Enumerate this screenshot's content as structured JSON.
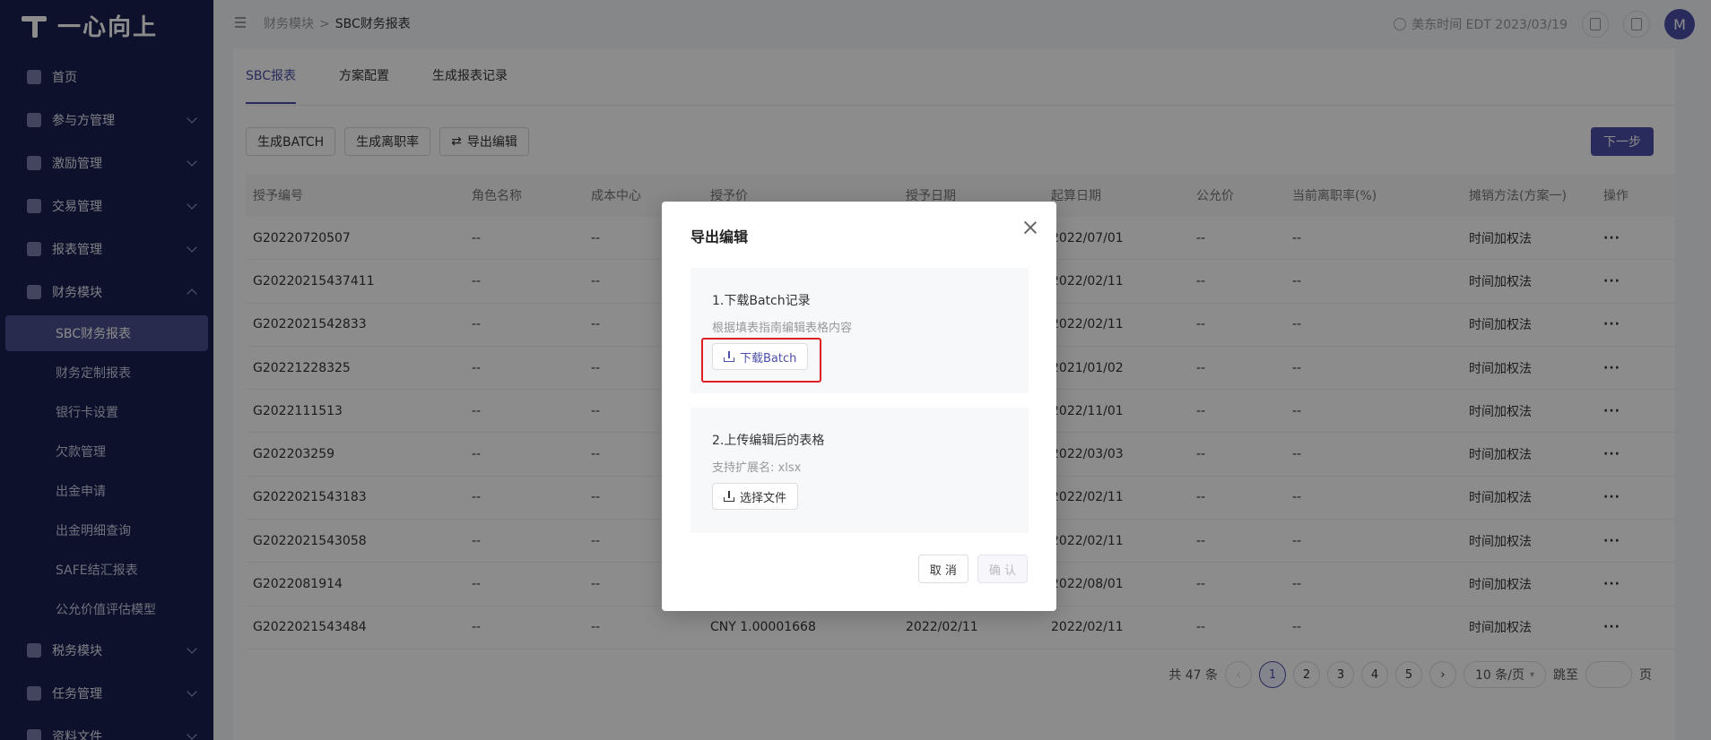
{
  "app": {
    "logo_text": "一心向上"
  },
  "sidebar": {
    "items": [
      {
        "label": "首页",
        "expandable": false
      },
      {
        "label": "参与方管理",
        "expandable": true
      },
      {
        "label": "激励管理",
        "expandable": true
      },
      {
        "label": "交易管理",
        "expandable": true
      },
      {
        "label": "报表管理",
        "expandable": true
      },
      {
        "label": "财务模块",
        "expandable": true,
        "expanded": true
      }
    ],
    "sub_items": [
      "SBC财务报表",
      "财务定制报表",
      "银行卡设置",
      "欠款管理",
      "出金申请",
      "出金明细查询",
      "SAFE结汇报表",
      "公允价值评估模型"
    ],
    "bottom_items": [
      {
        "label": "税务模块"
      },
      {
        "label": "任务管理"
      },
      {
        "label": "资料文件"
      }
    ]
  },
  "header": {
    "breadcrumb": [
      "财务模块",
      "SBC财务报表"
    ],
    "breadcrumb_sep": ">",
    "time_label": "美东时间 EDT 2023/03/19",
    "avatar_letter": "M"
  },
  "tabs": [
    "SBC报表",
    "方案配置",
    "生成报表记录"
  ],
  "toolbar": {
    "gen_batch": "生成BATCH",
    "gen_leave": "生成离职率",
    "export_edit": "导出编辑",
    "next": "下一步"
  },
  "table": {
    "columns": [
      "授予编号",
      "角色名称",
      "成本中心",
      "授予价",
      "授予日期",
      "起算日期",
      "公允价",
      "当前离职率(%)",
      "摊销方法(方案一)",
      "操作"
    ],
    "rows": [
      [
        "G20220720507",
        "--",
        "--",
        "",
        "",
        "2022/07/01",
        "--",
        "--",
        "时间加权法"
      ],
      [
        "G20220215437411",
        "--",
        "--",
        "",
        "",
        "2022/02/11",
        "--",
        "--",
        "时间加权法"
      ],
      [
        "G2022021542833",
        "--",
        "--",
        "",
        "",
        "2022/02/11",
        "--",
        "--",
        "时间加权法"
      ],
      [
        "G20221228325",
        "--",
        "--",
        "",
        "",
        "2021/01/02",
        "--",
        "--",
        "时间加权法"
      ],
      [
        "G2022111513",
        "--",
        "--",
        "",
        "",
        "2022/11/01",
        "--",
        "--",
        "时间加权法"
      ],
      [
        "G202203259",
        "--",
        "--",
        "",
        "",
        "2022/03/03",
        "--",
        "--",
        "时间加权法"
      ],
      [
        "G2022021543183",
        "--",
        "--",
        "",
        "",
        "2022/02/11",
        "--",
        "--",
        "时间加权法"
      ],
      [
        "G2022021543058",
        "--",
        "--",
        "",
        "",
        "2022/02/11",
        "--",
        "--",
        "时间加权法"
      ],
      [
        "G2022081914",
        "--",
        "--",
        "",
        "",
        "2022/08/01",
        "--",
        "--",
        "时间加权法"
      ],
      [
        "G2022021543484",
        "--",
        "--",
        "CNY 1.00001668",
        "2022/02/11",
        "2022/02/11",
        "--",
        "--",
        "时间加权法"
      ]
    ],
    "action_glyph": "···"
  },
  "pager": {
    "total": "共 47 条",
    "pages": [
      "1",
      "2",
      "3",
      "4",
      "5"
    ],
    "page_size": "10 条/页",
    "jump_label": "跳至",
    "page_unit": "页"
  },
  "modal": {
    "title": "导出编辑",
    "step1_title": "1.下载Batch记录",
    "step1_desc": "根据填表指南编辑表格内容",
    "step1_btn": "下载Batch",
    "step2_title": "2.上传编辑后的表格",
    "step2_desc": "支持扩展名: xlsx",
    "step2_btn": "选择文件",
    "cancel": "取 消",
    "confirm": "确 认"
  },
  "colors": {
    "sidebar_bg": "#1b1f4f",
    "accent": "#4b4fa8",
    "highlight": "#e02020"
  }
}
